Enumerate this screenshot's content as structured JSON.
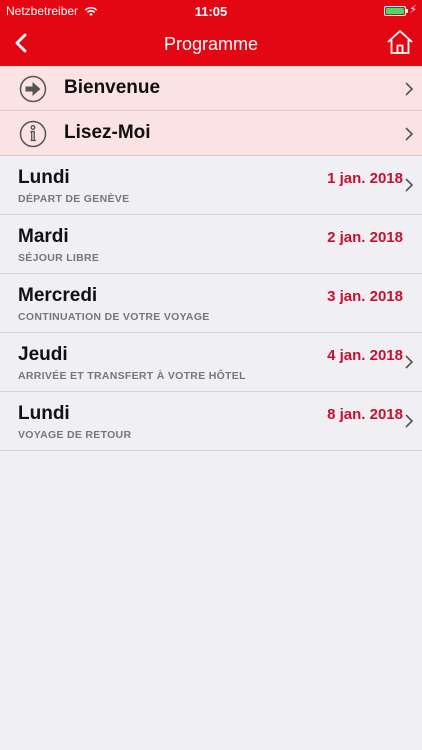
{
  "status_bar": {
    "carrier": "Netzbetreiber",
    "time": "11:05",
    "battery_level": 1.0,
    "charging_icon": "bolt-icon"
  },
  "nav_bar": {
    "title": "Programme",
    "back_icon": "chevron-left-icon",
    "home_icon": "home-icon"
  },
  "menu": {
    "items": [
      {
        "label": "Bienvenue",
        "icon": "arrow-right-circle-icon"
      },
      {
        "label": "Lisez-Moi",
        "icon": "info-circle-icon"
      }
    ]
  },
  "program": {
    "days": [
      {
        "day": "Lundi",
        "subtitle": "DÉPART DE GENÈVE",
        "date": "1 jan. 2018",
        "has_detail": true
      },
      {
        "day": "Mardi",
        "subtitle": "SÉJOUR LIBRE",
        "date": "2 jan. 2018",
        "has_detail": false
      },
      {
        "day": "Mercredi",
        "subtitle": "CONTINUATION DE VOTRE VOYAGE",
        "date": "3 jan. 2018",
        "has_detail": false
      },
      {
        "day": "Jeudi",
        "subtitle": "ARRIVÉE ET TRANSFERT À VOTRE HÔTEL",
        "date": "4 jan. 2018",
        "has_detail": true
      },
      {
        "day": "Lundi",
        "subtitle": "VOYAGE DE RETOUR",
        "date": "8 jan. 2018",
        "has_detail": true
      }
    ]
  },
  "colors": {
    "brand_red": "#e30613",
    "date_red": "#c8102e",
    "menu_bg": "#fbe3e3",
    "list_bg": "#efeff4"
  }
}
